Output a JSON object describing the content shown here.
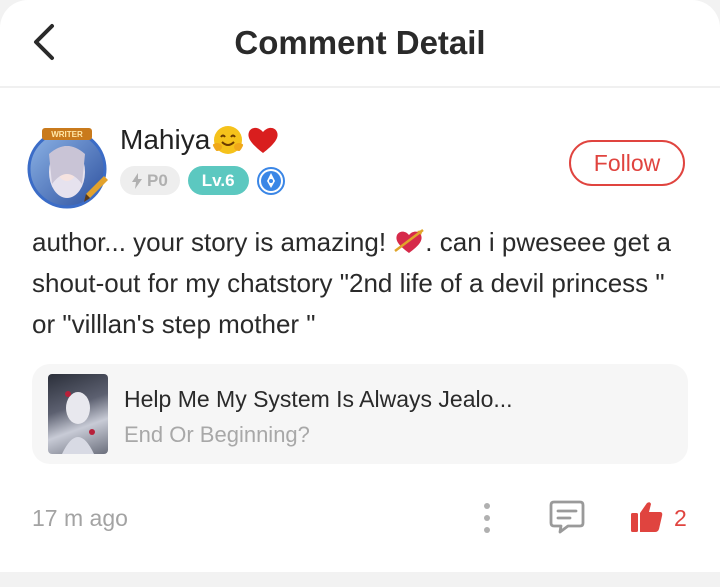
{
  "header": {
    "title": "Comment Detail"
  },
  "user": {
    "name": "Mahiya",
    "points_badge": "P0",
    "level_badge": "Lv.6",
    "avatar_badge_text": "WRITER"
  },
  "follow_label": "Follow",
  "comment": {
    "text_part1": "author... your story is amazing! ",
    "text_part2": ". can i pweseee get a shout-out for my chatstory \"2nd life of a devil princess \" or \"villlan's step mother \""
  },
  "book": {
    "title": "Help Me My System Is Always Jealo...",
    "chapter": "End Or Beginning?"
  },
  "footer": {
    "time": "17 m ago",
    "like_count": "2"
  },
  "colors": {
    "accent": "#e0443f",
    "level_badge": "#5cc8c0",
    "muted_text": "#a3a3a3"
  },
  "icons": [
    "back-chevron-icon",
    "hug-emoji-icon",
    "red-heart-emoji-icon",
    "lightning-icon",
    "ink-pen-badge-icon",
    "heart-arrow-emoji-icon",
    "more-vertical-icon",
    "reply-bubble-icon",
    "thumbs-up-icon"
  ]
}
